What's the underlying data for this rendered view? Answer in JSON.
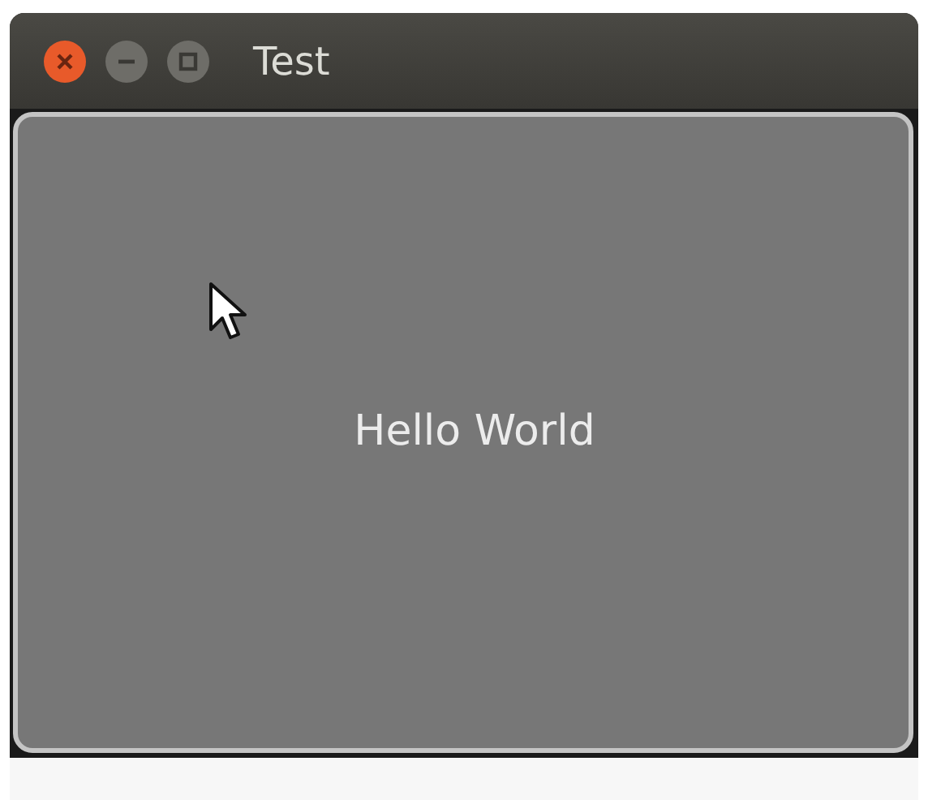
{
  "window": {
    "title": "Test"
  },
  "content": {
    "label": "Hello World"
  }
}
